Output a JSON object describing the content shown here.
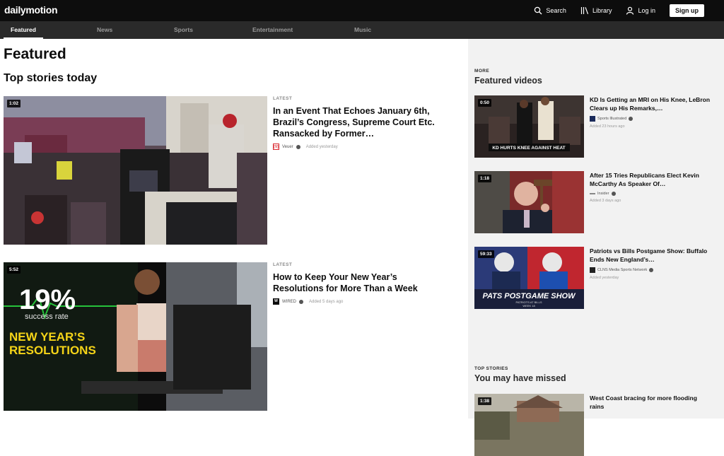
{
  "header": {
    "logo": "dailymotion",
    "search_label": "Search",
    "library_label": "Library",
    "login_label": "Log in",
    "signup_label": "Sign up"
  },
  "tabs": [
    {
      "label": "Featured",
      "active": true
    },
    {
      "label": "News",
      "active": false
    },
    {
      "label": "Sports",
      "active": false
    },
    {
      "label": "Entertainment",
      "active": false
    },
    {
      "label": "Music",
      "active": false
    }
  ],
  "main": {
    "page_title": "Featured",
    "section_title": "Top stories today",
    "stories": [
      {
        "duration": "1:02",
        "kicker": "LATEST",
        "title": "In an Event That Echoes January 6th, Brazil’s Congress, Supreme Court Etc. Ransacked by Former…",
        "channel": "Veuer",
        "channel_icon": "[V]",
        "added": "Added yesterday"
      },
      {
        "duration": "5:52",
        "kicker": "LATEST",
        "title": "How to Keep Your New Year’s Resolutions for More Than a Week",
        "channel": "WIRED",
        "channel_icon": "W",
        "added": "Added 5 days ago",
        "thumb_text": {
          "percent": "19%",
          "rate": "success rate",
          "line1": "NEW YEAR’S",
          "line2": "RESOLUTIONS"
        }
      }
    ]
  },
  "sidebar": {
    "featured_kicker": "MORE",
    "featured_title": "Featured videos",
    "featured": [
      {
        "duration": "0:50",
        "title": "KD Is Getting an MRI on His Knee, LeBron Clears up His Remarks,…",
        "channel": "Sports Illustrated",
        "added": "Added 23 hours ago",
        "caption": "KD HURTS KNEE AGAINST HEAT"
      },
      {
        "duration": "1:18",
        "title": "After 15 Tries Republicans Elect Kevin McCarthy As Speaker Of…",
        "channel": "Insider",
        "added": "Added 3 days ago"
      },
      {
        "duration": "59:33",
        "title": "Patriots vs Bills Postgame Show: Buffalo Ends New England’s…",
        "channel": "CLNS Media Sports Network",
        "added": "Added yesterday",
        "caption": "PATS POSTGAME SHOW",
        "subcaption": "PATRIOTS AT BILLS",
        "subcaption2": "WEEK 18"
      }
    ],
    "missed_kicker": "TOP STORIES",
    "missed_title": "You may have missed",
    "missed": [
      {
        "duration": "1:38",
        "title": "West Coast bracing for more flooding rains"
      }
    ]
  },
  "colors": {
    "topbar": "#0d0d0d",
    "tabbar": "#2a2a2a",
    "sidebar_bg": "#f2f2f2",
    "veuer_red": "#d8232a"
  }
}
